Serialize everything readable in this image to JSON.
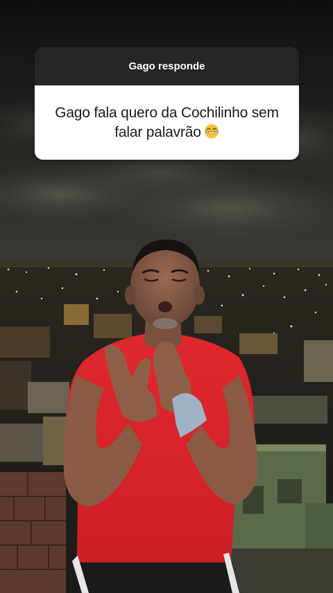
{
  "story": {
    "question_sticker": {
      "header": "Gago responde",
      "question": "Gago fala quero da Cochilinho sem falar palavrão",
      "emoji_icon": "face-with-tears-of-joy-icon"
    }
  },
  "colors": {
    "sticker_header_bg": "#262626",
    "sticker_body_bg": "#ffffff",
    "shirt": "#e0282e"
  }
}
